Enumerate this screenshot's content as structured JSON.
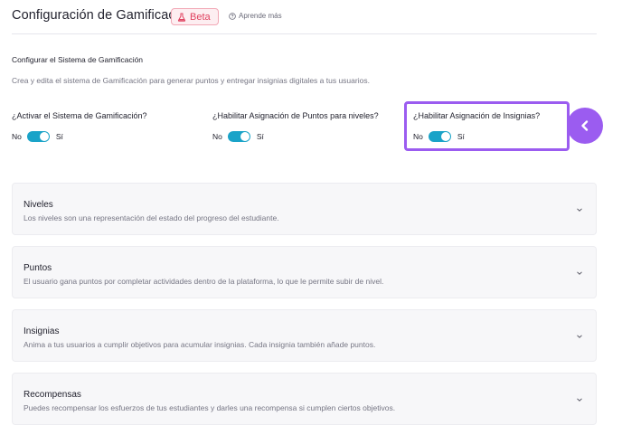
{
  "header": {
    "title": "Configuración de Gamificación",
    "badge_label": "Beta",
    "help_label": "Aprende más"
  },
  "section": {
    "title": "Configurar el Sistema de Gamificación",
    "description": "Crea y edita el sistema de Gamificación para generar puntos y entregar insignias digitales a tus usuarios."
  },
  "toggles": [
    {
      "question": "¿Activar el Sistema de Gamificación?",
      "off_label": "No",
      "on_label": "Sí",
      "enabled": true
    },
    {
      "question": "¿Habilitar Asignación de Puntos para niveles?",
      "off_label": "No",
      "on_label": "Sí",
      "enabled": true
    },
    {
      "question": "¿Habilitar Asignación de Insignias?",
      "off_label": "No",
      "on_label": "Sí",
      "enabled": true
    }
  ],
  "cards": [
    {
      "title": "Niveles",
      "description": "Los niveles son una representación del estado del progreso del estudiante."
    },
    {
      "title": "Puntos",
      "description": "El usuario gana puntos por completar actividades dentro de la plataforma, lo que le permite subir de nivel."
    },
    {
      "title": "Insignias",
      "description": "Anima a tus usuarios a cumplir objetivos para acumular insignias. Cada insignia también añade puntos."
    },
    {
      "title": "Recompensas",
      "description": "Puedes recompensar los esfuerzos de tus estudiantes y darles una recompensa si cumplen ciertos objetivos."
    }
  ],
  "colors": {
    "accent": "#1aa3c8",
    "highlight": "#9b5cf0",
    "badge": "#e0415f"
  },
  "icons": {
    "badge": "flask-icon",
    "help": "help-circle-icon",
    "pointer": "chevron-left-icon",
    "card_toggle": "chevron-down-icon"
  }
}
